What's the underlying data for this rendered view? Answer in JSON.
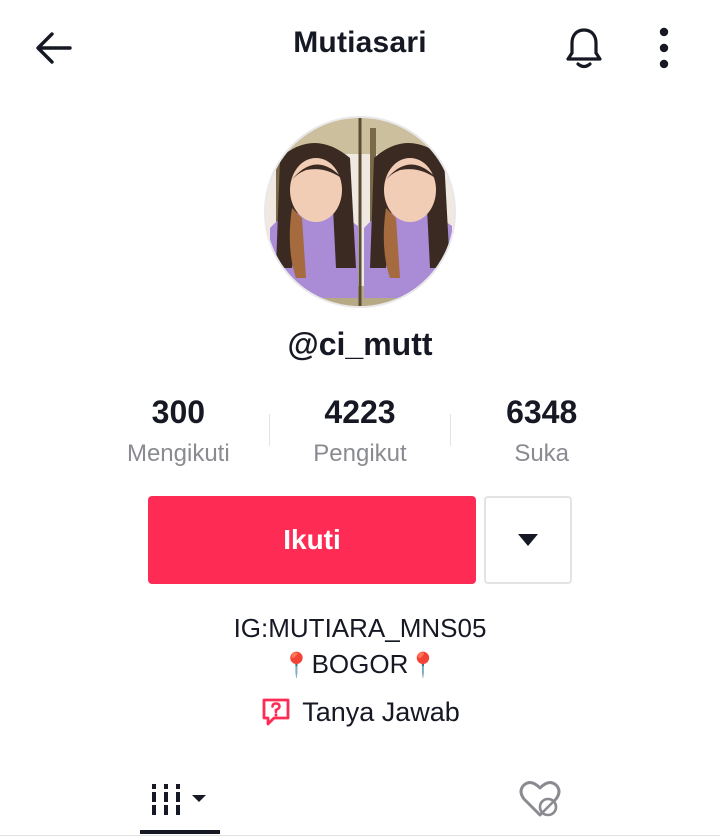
{
  "header": {
    "title": "Mutiasari",
    "back_icon": "arrow-left-icon",
    "bell_icon": "bell-icon",
    "more_icon": "more-vertical-icon"
  },
  "profile": {
    "username": "@ci_mutt",
    "avatar_alt": "avatar"
  },
  "stats": [
    {
      "value": "300",
      "label": "Mengikuti"
    },
    {
      "value": "4223",
      "label": "Pengikut"
    },
    {
      "value": "6348",
      "label": "Suka"
    }
  ],
  "actions": {
    "follow_label": "Ikuti",
    "dropdown_icon": "caret-down-icon"
  },
  "bio": {
    "line1": "IG:MUTIARA_MNS05",
    "line2_pin_left": "📍",
    "line2_text": "BOGOR",
    "line2_pin_right": "📍"
  },
  "qa": {
    "label": "Tanya Jawab",
    "icon": "question-chat-icon"
  },
  "tabs": {
    "videos_icon": "grid-videos-icon",
    "liked_icon": "liked-hidden-icon"
  },
  "colors": {
    "accent": "#fe2c55",
    "text": "#161823",
    "muted": "#8a8b91",
    "border": "#e3e3e4",
    "pin": "#e5283c"
  }
}
